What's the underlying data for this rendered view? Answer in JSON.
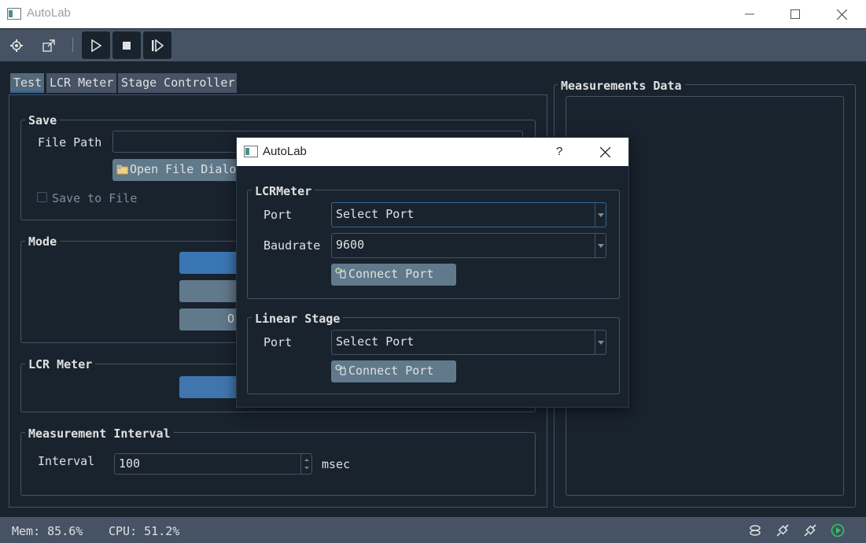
{
  "window": {
    "title": "AutoLab"
  },
  "tabs": [
    {
      "label": "Test",
      "active": true
    },
    {
      "label": "LCR Meter",
      "active": false
    },
    {
      "label": "Stage Controller",
      "active": false
    }
  ],
  "save_group": {
    "title": "Save",
    "file_path_label": "File Path",
    "file_path_value": "",
    "open_button": "Open File Dialo",
    "save_to_file_label": "Save to File",
    "save_to_file_checked": false
  },
  "mode_group": {
    "title": "Mode",
    "button3_partial": "O"
  },
  "lcr_group": {
    "title": "LCR Meter"
  },
  "interval_group": {
    "title": "Measurement Interval",
    "label": "Interval",
    "value": "100",
    "unit": "msec"
  },
  "measurements": {
    "title": "Measurements Data"
  },
  "status": {
    "mem": "Mem: 85.6%",
    "cpu": "CPU: 51.2%"
  },
  "dialog": {
    "title": "AutoLab",
    "help": "?",
    "lcr": {
      "title": "LCRMeter",
      "port_label": "Port",
      "port_value": "Select Port",
      "baud_label": "Baudrate",
      "baud_value": "9600",
      "connect_label": "Connect Port"
    },
    "stage": {
      "title": "Linear Stage",
      "port_label": "Port",
      "port_value": "Select Port",
      "connect_label": "Connect Port"
    }
  },
  "colors": {
    "background": "#19232d",
    "panel": "#455364",
    "accent": "#346792",
    "button": "#60798b"
  }
}
